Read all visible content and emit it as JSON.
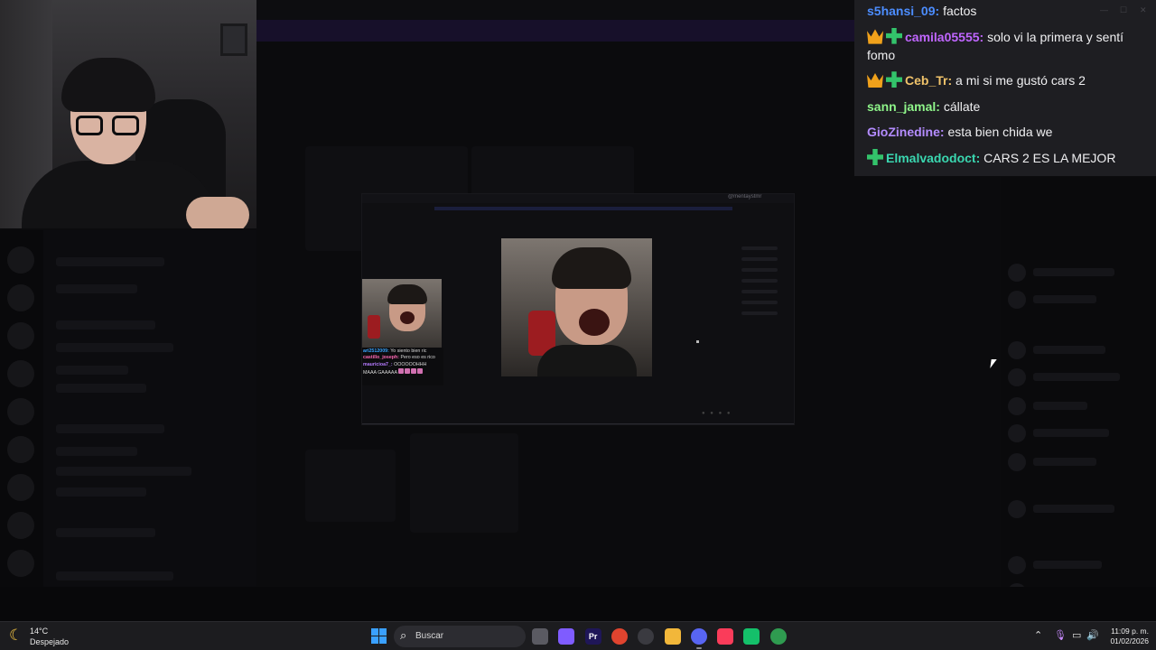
{
  "chat": {
    "messages": [
      {
        "user": "s5hansi_09",
        "color": "#4c8dff",
        "badges": [],
        "text": "factos"
      },
      {
        "user": "camila05555",
        "color": "#c066ff",
        "badges": [
          "crown-badge",
          "plus-badge"
        ],
        "text": "solo vi la primera y sentí fomo"
      },
      {
        "user": "Ceb_Tr",
        "color": "#f0c36a",
        "badges": [
          "crown-badge",
          "plus-badge"
        ],
        "text": "a mi si me gustó cars 2"
      },
      {
        "user": "sann_jamal",
        "color": "#8ff58a",
        "badges": [],
        "text": "cállate"
      },
      {
        "user": "GioZinedine",
        "color": "#b48cff",
        "badges": [],
        "text": "esta bien chida we"
      },
      {
        "user": "Elmalvadodoct",
        "color": "#3ad7b0",
        "badges": [
          "plus-badge"
        ],
        "text": "CARS 2 ES LA MEJOR"
      }
    ]
  },
  "stream": {
    "handle": "@mentaystmr",
    "mini_chat": [
      {
        "user": "ari2512009:",
        "text": " Yo siento bien ric"
      },
      {
        "user": "castillo_joseph:",
        "text": " Pero eso es rico"
      },
      {
        "user": "mauricioa7_:",
        "text": " OOOOOOHHH"
      },
      {
        "user": "",
        "text": "MAAA GAAAAA"
      }
    ]
  },
  "taskbar": {
    "weather_temp": "14°C",
    "weather_condition": "Despejado",
    "search_placeholder": "Buscar",
    "time": "11:09 p. m.",
    "date": "01/02/2026",
    "pinned": [
      {
        "name": "task-view-icon",
        "label": "",
        "color": "#5a5a62"
      },
      {
        "name": "copilot-icon",
        "label": "",
        "color": "#7f5cff"
      },
      {
        "name": "premiere-icon",
        "label": "Pr",
        "color": "#1f1658"
      },
      {
        "name": "chrome-icon",
        "label": "",
        "color": "#e0442f"
      },
      {
        "name": "obs-icon",
        "label": "",
        "color": "#3a3a40"
      },
      {
        "name": "file-explorer-icon",
        "label": "",
        "color": "#f2b73a"
      },
      {
        "name": "discord-icon",
        "label": "",
        "color": "#5865f2"
      },
      {
        "name": "apple-music-icon",
        "label": "",
        "color": "#fa3c5a"
      },
      {
        "name": "capcut-icon",
        "label": "",
        "color": "#14c06a"
      },
      {
        "name": "chrome-profile-icon",
        "label": "",
        "color": "#2f9b50"
      }
    ]
  }
}
